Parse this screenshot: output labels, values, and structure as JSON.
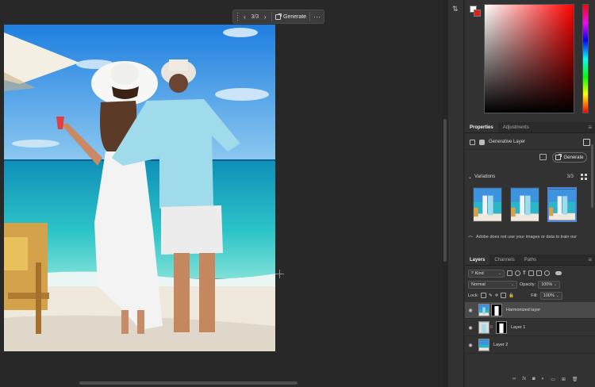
{
  "context_bar": {
    "prev_icon": "chevron-left-icon",
    "counter": "3/3",
    "next_icon": "chevron-right-icon",
    "generate_label": "Generate",
    "more_icon": "more-icon"
  },
  "colors": {
    "foreground": "#ffffff",
    "background": "#e0201f",
    "selection_blue": "#4f86d8"
  },
  "properties": {
    "tabs": [
      "Properties",
      "Adjustments"
    ],
    "layer_type": "Generative Layer",
    "generate_label": "Generate",
    "variations_label": "Variations",
    "variations_count": "3/3",
    "notice": "Adobe does not use your images or data to train our"
  },
  "layers_panel": {
    "tabs": [
      "Layers",
      "Channels",
      "Paths"
    ],
    "kind_label": "Kind",
    "blend_mode": "Normal",
    "opacity_label": "Opacity:",
    "opacity_value": "100%",
    "lock_label": "Lock:",
    "fill_label": "Fill:",
    "fill_value": "100%",
    "layers": [
      {
        "name": "Harmonized layer",
        "selected": true,
        "has_mask": true
      },
      {
        "name": "Layer 1",
        "selected": false,
        "has_mask": true
      },
      {
        "name": "Layer 2",
        "selected": false,
        "has_mask": false
      }
    ],
    "footer_icons": [
      "link-icon",
      "fx-icon",
      "mask-icon",
      "adjustment-icon",
      "folder-icon",
      "new-layer-icon",
      "trash-icon"
    ]
  }
}
